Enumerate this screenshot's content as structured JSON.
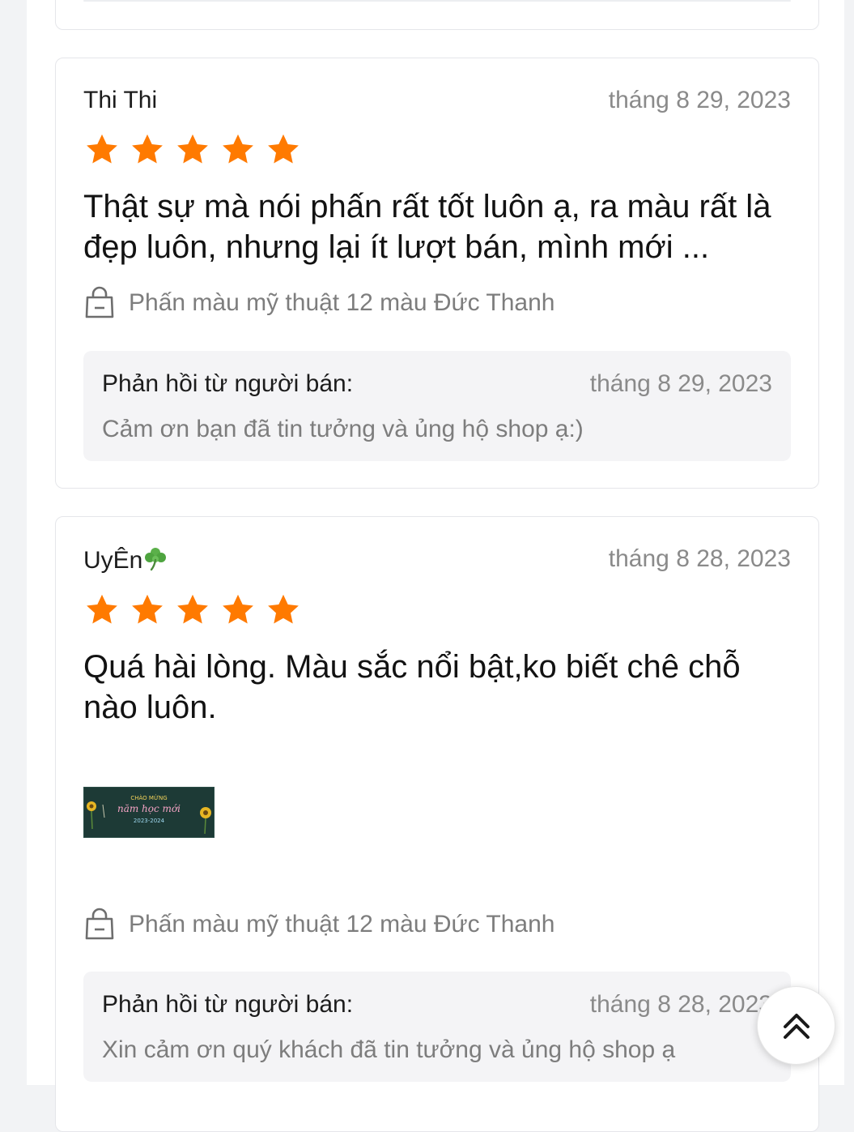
{
  "reviews": [
    {
      "reviewer": "Thi Thi",
      "date": "tháng 8 29, 2023",
      "rating": 5,
      "text": "Thật sự mà nói phấn rất tốt luôn ạ, ra màu rất là đẹp luôn, nhưng lại ít lượt bán, mình mới ...",
      "product": "Phấn màu mỹ thuật 12 màu Đức Thanh",
      "reply": {
        "label": "Phản hồi từ người bán:",
        "date": "tháng 8 29, 2023",
        "text": "Cảm ơn bạn đã tin tưởng và ủng hộ shop ạ:)"
      }
    },
    {
      "reviewer": "UyÊn",
      "reviewer_icon": "clover-icon",
      "date": "tháng 8 28, 2023",
      "rating": 5,
      "text": "Quá hài lòng. Màu sắc nổi bật,ko biết chê chỗ nào luôn.",
      "image": {
        "icon": "chalkboard-photo",
        "lines": [
          "CHÀO MỪNG",
          "năm học mới",
          "2023-2024"
        ]
      },
      "product": "Phấn màu mỹ thuật 12 màu Đức Thanh",
      "reply": {
        "label": "Phản hồi từ người bán:",
        "date": "tháng 8 28, 2023",
        "text": "Xin cảm ơn quý khách đã tin tưởng và ủng hộ shop ạ"
      }
    }
  ],
  "icons": {
    "star": "star-icon",
    "bag": "shopping-bag-icon",
    "scroll_top": "double-chevron-up-icon"
  },
  "colors": {
    "star": "#ff7a00",
    "page_background": "#f2f3f5",
    "card_background": "#ffffff",
    "reply_background": "#f4f4f6",
    "muted_text": "#8a8a8a"
  }
}
